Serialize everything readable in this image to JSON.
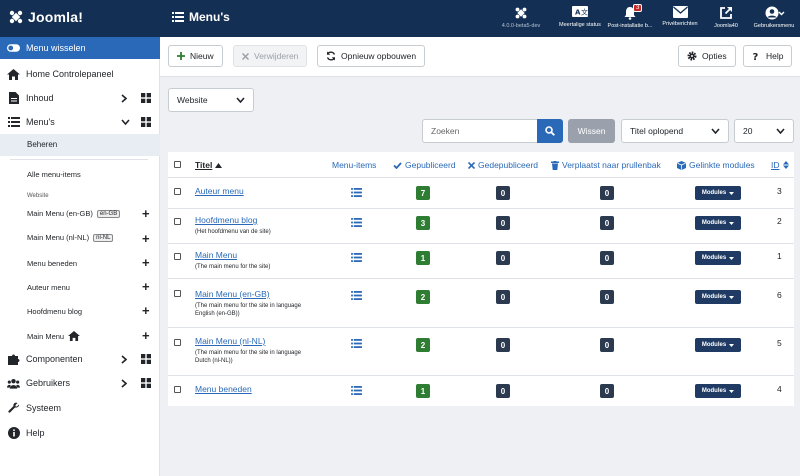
{
  "topbar": {
    "logo_text": "Joomla!",
    "page_title": "Menu's",
    "version": "4.0.0-beta5-dev",
    "items": [
      {
        "label": "Meertalige status"
      },
      {
        "label": "Post-installatie b...",
        "badge": "3"
      },
      {
        "label": "Privéberichten"
      },
      {
        "label": "Joomla40"
      },
      {
        "label": "Gebruikersmenu"
      }
    ]
  },
  "sidebar": {
    "toggle_label": "Menu wisselen",
    "items": [
      {
        "label": "Home Controlepaneel"
      },
      {
        "label": "Inhoud"
      },
      {
        "label": "Menu's"
      },
      {
        "label": "Componenten"
      },
      {
        "label": "Gebruikers"
      },
      {
        "label": "Systeem"
      },
      {
        "label": "Help"
      }
    ],
    "active_sub": "Beheren",
    "all_menu_items": "Alle menu-items",
    "category": "Website",
    "menus": [
      {
        "label": "Main Menu (en-GB)",
        "lang": "en-GB"
      },
      {
        "label": "Main Menu (nl-NL)",
        "lang": "nl-NL"
      },
      {
        "label": "Menu beneden"
      },
      {
        "label": "Auteur menu"
      },
      {
        "label": "Hoofdmenu blog"
      },
      {
        "label": "Main Menu"
      }
    ]
  },
  "toolbar": {
    "new_label": "Nieuw",
    "delete_label": "Verwijderen",
    "rebuild_label": "Opnieuw opbouwen",
    "options_label": "Opties",
    "help_label": "Help"
  },
  "filters": {
    "site_value": "Website",
    "search_placeholder": "Zoeken",
    "clear_label": "Wissen",
    "order_value": "Titel oplopend",
    "limit_value": "20"
  },
  "table": {
    "headers": {
      "title": "Titel",
      "menu_items": "Menu-items",
      "published": "Gepubliceerd",
      "unpublished": "Gedepubliceerd",
      "trashed": "Verplaatst naar prullenbak",
      "modules": "Gelinkte modules",
      "id": "ID"
    },
    "modules_label": "Modules",
    "rows": [
      {
        "title": "Auteur menu",
        "desc": "",
        "published": "7",
        "unpublished": "0",
        "trashed": "0",
        "id": "3"
      },
      {
        "title": "Hoofdmenu blog",
        "desc": "(Het hoofdmenu van de site)",
        "published": "3",
        "unpublished": "0",
        "trashed": "0",
        "id": "2"
      },
      {
        "title": "Main Menu",
        "desc": "(The main menu for the site)",
        "published": "1",
        "unpublished": "0",
        "trashed": "0",
        "id": "1"
      },
      {
        "title": "Main Menu (en-GB)",
        "desc": "(The main menu for the site in language English (en-GB))",
        "published": "2",
        "unpublished": "0",
        "trashed": "0",
        "id": "6"
      },
      {
        "title": "Main Menu (nl-NL)",
        "desc": "(The main menu for the site in language Dutch (nl-NL))",
        "published": "2",
        "unpublished": "0",
        "trashed": "0",
        "id": "5"
      },
      {
        "title": "Menu beneden",
        "desc": "",
        "published": "1",
        "unpublished": "0",
        "trashed": "0",
        "id": "4"
      }
    ]
  },
  "colors": {
    "topbar": "#132f53",
    "accent": "#2a69b8",
    "published": "#2e7d32",
    "neutral": "#2b3a4f"
  }
}
